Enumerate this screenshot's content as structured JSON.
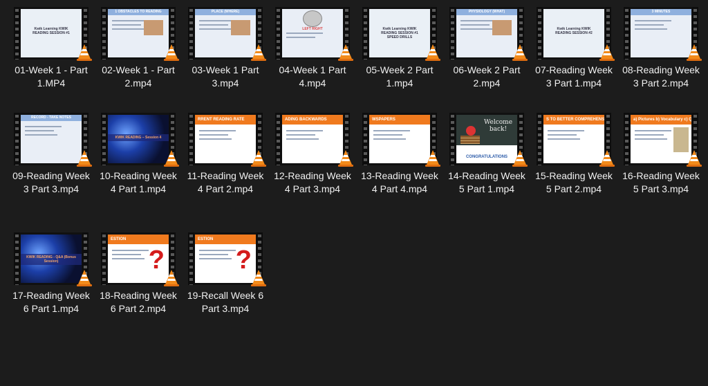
{
  "folder_view": {
    "items": [
      {
        "label": "01-Week 1 - Part 1.MP4",
        "thumb": "Kwik Learning KWIK READING SESSION #1",
        "kind": "title"
      },
      {
        "label": "02-Week 1 - Part 2.mp4",
        "thumb": "1 OBSTACLES TO READING",
        "kind": "slide-photo"
      },
      {
        "label": "03-Week 1 Part 3.mp4",
        "thumb": "PLACE (WHERE)",
        "kind": "slide-photo"
      },
      {
        "label": "04-Week 1 Part 4.mp4",
        "thumb": "LEFT  RIGHT",
        "kind": "brain"
      },
      {
        "label": "05-Week 2 Part 1.mp4",
        "thumb": "Kwik Learning KWIK READING SESSION #1 SPEED DRILLS",
        "kind": "title"
      },
      {
        "label": "06-Week 2 Part 2.mp4",
        "thumb": "PHYSIOLOGY (WHAT)",
        "kind": "slide-photo"
      },
      {
        "label": "07-Reading Week 3 Part 1.mp4",
        "thumb": "Kwik Learning KWIK READING SESSION #2",
        "kind": "title"
      },
      {
        "label": "08-Reading Week 3 Part 2.mp4",
        "thumb": "3 MINUTES",
        "kind": "slide"
      },
      {
        "label": "09-Reading Week 3 Part 3.mp4",
        "thumb": "RECORD - TAKE NOTES",
        "kind": "slide"
      },
      {
        "label": "10-Reading Week 4 Part 1.mp4",
        "thumb": "KWIK READING – Session 4",
        "kind": "blue"
      },
      {
        "label": "11-Reading Week 4 Part 2.mp4",
        "thumb": "RRENT READING RATE",
        "kind": "orange"
      },
      {
        "label": "12-Reading Week 4 Part 3.mp4",
        "thumb": "ADING BACKWARDS",
        "kind": "orange"
      },
      {
        "label": "13-Reading Week 4 Part 4.mp4",
        "thumb": "WSPAPERS",
        "kind": "orange"
      },
      {
        "label": "14-Reading Week 5 Part 1.mp4",
        "thumb": "CONGRATULATIONS",
        "kind": "welcome"
      },
      {
        "label": "15-Reading Week 5 Part 2.mp4",
        "thumb": "S TO BETTER COMPREHENSION",
        "kind": "orange"
      },
      {
        "label": "16-Reading Week 5 Part 3.mp4",
        "thumb": "a) Pictures b) Vocabulary c) Questions",
        "kind": "orange-map"
      },
      {
        "label": "17-Reading Week 6 Part 1.mp4",
        "thumb": "KWIK READING - Q&A (Bonus Session)",
        "kind": "blue"
      },
      {
        "label": "18-Reading Week 6 Part 2.mp4",
        "thumb": "ESTION",
        "kind": "orange-q"
      },
      {
        "label": "19-Recall Week 6 Part 3.mp4",
        "thumb": "ESTION",
        "kind": "orange-q"
      }
    ]
  },
  "colors": {
    "background": "#1c1c1c",
    "text": "#f0f0f0",
    "accent_orange": "#f07a1e"
  }
}
